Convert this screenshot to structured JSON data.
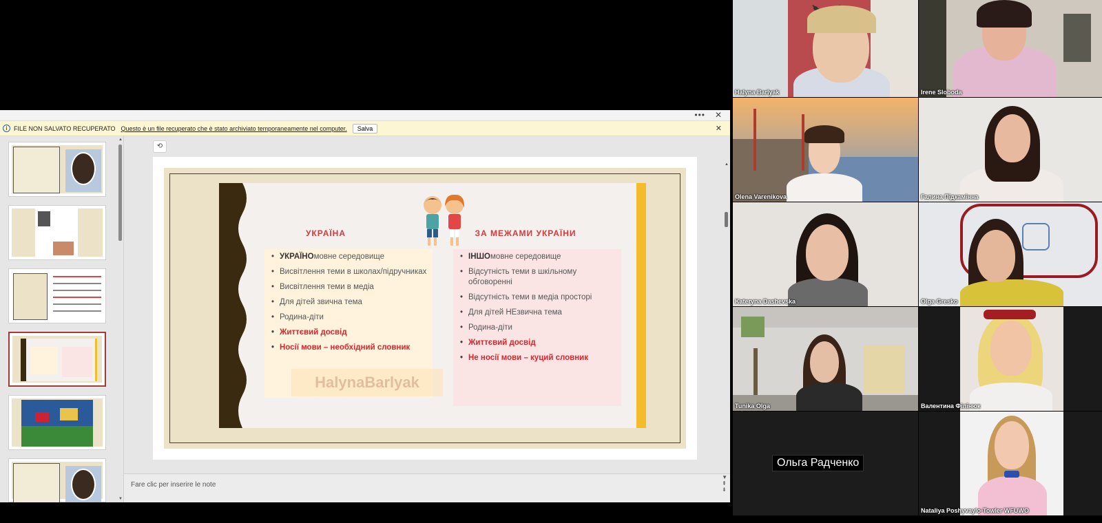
{
  "infobar": {
    "title": "FILE NON SALVATO RECUPERATO",
    "message": "Questo è un file recuperato che è stato archiviato temporaneamente nel computer.",
    "save_label": "Salva"
  },
  "slide": {
    "left_heading": "УКРАЇНА",
    "right_heading": "ЗА МЕЖАМИ УКРАЇНИ",
    "left_items": [
      {
        "bold": "УКРАЇНО",
        "text": "мовне середовище",
        "red": false
      },
      {
        "bold": "",
        "text": "Висвітлення теми в школах/підручниках",
        "red": false
      },
      {
        "bold": "",
        "text": "Висвітлення теми в медіа",
        "red": false
      },
      {
        "bold": "",
        "text": "Для дітей звична тема",
        "red": false
      },
      {
        "bold": "",
        "text": "Родина-діти",
        "red": false
      },
      {
        "bold": "",
        "text": "Життєвий досвід",
        "red": true
      },
      {
        "bold": "",
        "text": "Носії мови – необхідний словник",
        "red": true
      }
    ],
    "right_items": [
      {
        "bold": "ІНШО",
        "text": "мовне середовище",
        "red": false
      },
      {
        "bold": "",
        "text": "Відсутність теми в шкільному обговоренні",
        "red": false
      },
      {
        "bold": "",
        "text": "Відсутність теми в медіа просторі",
        "red": false
      },
      {
        "bold": "",
        "text": "Для дітей НЕзвична тема",
        "red": false
      },
      {
        "bold": "",
        "text": "Родина-діти",
        "red": false
      },
      {
        "bold": "",
        "text": "Життєвий досвід",
        "red": true
      },
      {
        "bold": "",
        "text": "Не носії мови – куций словник",
        "red": true
      }
    ],
    "watermark": "HalynaBarlyak"
  },
  "notes_placeholder": "Fare clic per inserire le note",
  "participants": [
    {
      "name": "Halyna Barlyak"
    },
    {
      "name": "Irene Sloboda"
    },
    {
      "name": "Olena Varenikova"
    },
    {
      "name": "Галина Підкамінна"
    },
    {
      "name": "Kateryna Dashevska"
    },
    {
      "name": "Olga Gresko"
    },
    {
      "name": "Tunika Olga"
    },
    {
      "name": "Валентина Філінюк"
    },
    {
      "name": "Ольга Радченко"
    },
    {
      "name": "Nataliya Poshyvaylo-Towler WFUWO"
    }
  ]
}
